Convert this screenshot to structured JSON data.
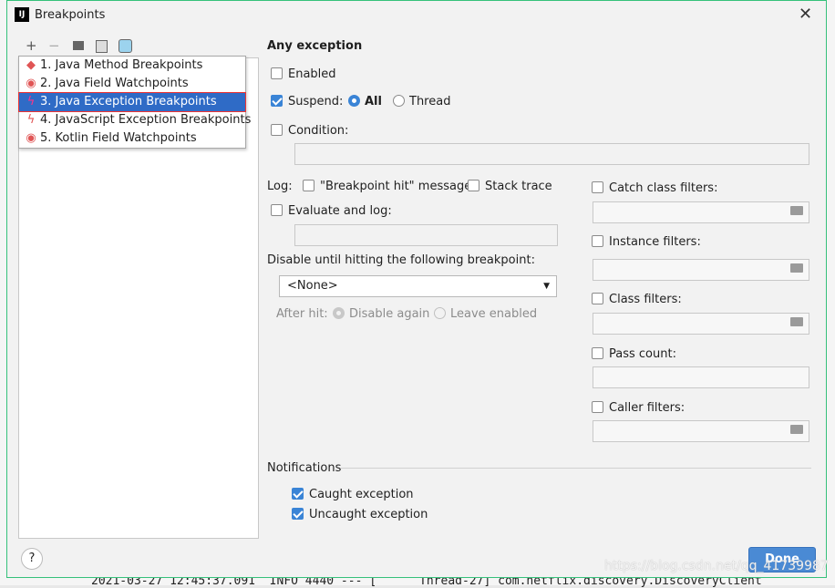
{
  "window": {
    "title": "Breakpoints"
  },
  "toolbar": {
    "add": "+",
    "remove": "−"
  },
  "popup_items": [
    {
      "label": "1. Java Method Breakpoints",
      "icon": "diamond-icon"
    },
    {
      "label": "2. Java Field Watchpoints",
      "icon": "eye-icon"
    },
    {
      "label": "3. Java Exception Breakpoints",
      "icon": "lightning-icon",
      "selected": true
    },
    {
      "label": "4. JavaScript Exception Breakpoints",
      "icon": "lightning-icon"
    },
    {
      "label": "5. Kotlin Field Watchpoints",
      "icon": "eye-icon"
    }
  ],
  "details": {
    "heading": "Any exception",
    "enabled": "Enabled",
    "suspend": "Suspend:",
    "all": "All",
    "thread": "Thread",
    "condition": "Condition:",
    "log": "Log:",
    "bp_hit": "\"Breakpoint hit\" message",
    "stack_trace": "Stack trace",
    "evaluate": "Evaluate and log:",
    "disable_until": "Disable until hitting the following breakpoint:",
    "none_option": "<None>",
    "after_hit": "After hit:",
    "disable_again": "Disable again",
    "leave_enabled": "Leave enabled",
    "catch_filters": "Catch class filters:",
    "instance_filters": "Instance filters:",
    "class_filters": "Class filters:",
    "pass_count": "Pass count:",
    "caller_filters": "Caller filters:",
    "notifications": "Notifications",
    "caught": "Caught exception",
    "uncaught": "Uncaught exception"
  },
  "footer": {
    "help": "?",
    "done": "Done"
  },
  "background_log": "2021-03-27 12:45:37.091  INFO 4440 --- [      Thread-27] com.netflix.discovery.DiscoveryClient",
  "watermark": "https://blog.csdn.net/qq_41739987",
  "colors": {
    "accent": "#2f6bc6",
    "button": "#4a8ad4",
    "dialog_border": "#35c17a"
  }
}
